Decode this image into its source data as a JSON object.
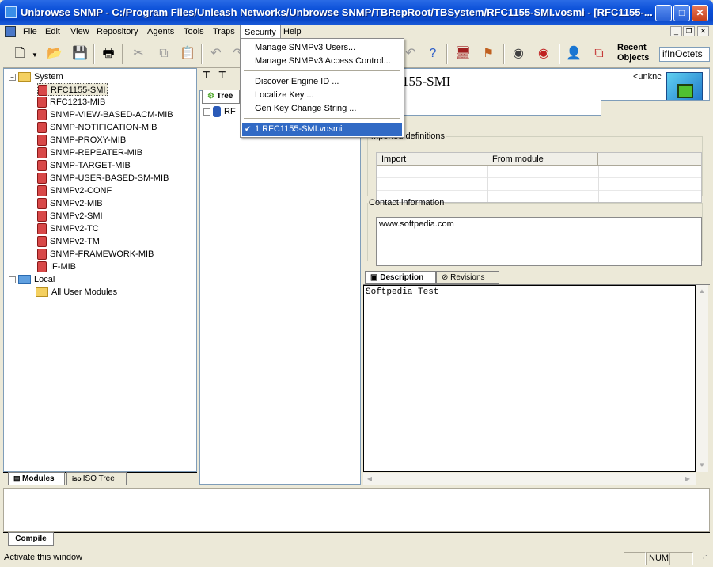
{
  "window": {
    "title": "Unbrowse SNMP  - C:/Program Files/Unleash Networks/Unbrowse SNMP/TBRepRoot/TBSystem/RFC1155-SMI.vosmi - [RFC1155-...",
    "minimize": "_",
    "maximize": "□",
    "close": "✕"
  },
  "menubar": {
    "items": [
      "File",
      "Edit",
      "View",
      "Repository",
      "Agents",
      "Tools",
      "Traps",
      "Security",
      "Help"
    ],
    "mdi_min": "_",
    "mdi_restore": "❐",
    "mdi_close": "✕"
  },
  "security_menu": {
    "items": [
      "Manage SNMPv3 Users...",
      "Manage SNMPv3 Access Control...",
      "Discover Engine ID ...",
      "Localize Key ...",
      "Gen Key Change String ...",
      "1 RFC1155-SMI.vosmi"
    ],
    "checked": "✔"
  },
  "toolbar": {
    "recent_objects_label": "Recent Objects",
    "recent_objects_value": "ifInOctets"
  },
  "modules_tree": {
    "system_label": "System",
    "system_items": [
      "RFC1155-SMI",
      "RFC1213-MIB",
      "SNMP-VIEW-BASED-ACM-MIB",
      "SNMP-NOTIFICATION-MIB",
      "SNMP-PROXY-MIB",
      "SNMP-REPEATER-MIB",
      "SNMP-TARGET-MIB",
      "SNMP-USER-BASED-SM-MIB",
      "SNMPv2-CONF",
      "SNMPv2-MIB",
      "SNMPv2-SMI",
      "SNMPv2-TC",
      "SNMPv2-TM",
      "SNMP-FRAMEWORK-MIB",
      "IF-MIB"
    ],
    "local_label": "Local",
    "local_items": [
      "All User Modules"
    ],
    "expander_minus": "−",
    "tabs": [
      "Modules",
      "ISO Tree"
    ]
  },
  "tree_pane": {
    "tab_label": "Tree",
    "node_label": "RF",
    "expander_plus": "+"
  },
  "detail": {
    "module_title": "155-SMI",
    "unknown_label": "<unknc",
    "imported_definitions_label": "Imported definitions",
    "columns": [
      "Import",
      "From module"
    ],
    "contact_label": "Contact information",
    "contact_value": "www.softpedia.com",
    "tabs": [
      "Description",
      "Revisions"
    ],
    "description_text": "Softpedia Test"
  },
  "bottom": {
    "tab": "Compile"
  },
  "statusbar": {
    "text": "Activate this window",
    "num": "NUM"
  }
}
